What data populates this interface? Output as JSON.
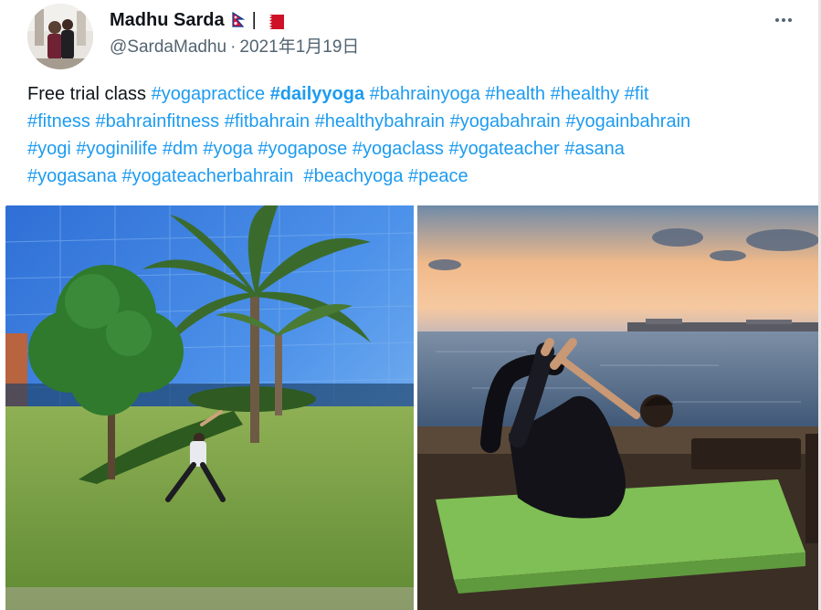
{
  "author": {
    "display_name": "Madhu Sarda",
    "name_separator": "|",
    "handle": "@SardaMadhu",
    "date": "2021年1月19日",
    "flags": [
      "nepal-flag",
      "bahrain-flag"
    ]
  },
  "tweet": {
    "intro": "Free trial class",
    "hashtags": [
      "#yogapractice",
      "#dailyyoga",
      "#bahrainyoga",
      "#health",
      "#healthy",
      "#fit",
      "#fitness",
      "#bahrainfitness",
      "#fitbahrain",
      "#healthybahrain",
      "#yogabahrain",
      "#yogainbahrain",
      "#yogi",
      "#yoginilife",
      "#dm",
      "#yoga",
      "#yogapose",
      "#yogaclass",
      "#yogateacher",
      "#asana",
      "#yogasana",
      "#yogateacherbahrain",
      "#beachyoga",
      "#peace"
    ]
  },
  "media": {
    "photos": [
      "photo-yoga-palm-tree",
      "photo-yoga-sunset-sea"
    ]
  },
  "colors": {
    "link": "#1d9bf0",
    "secondary_text": "#536471",
    "primary_text": "#0f1419"
  },
  "icons": {
    "more": "more-options-icon"
  }
}
